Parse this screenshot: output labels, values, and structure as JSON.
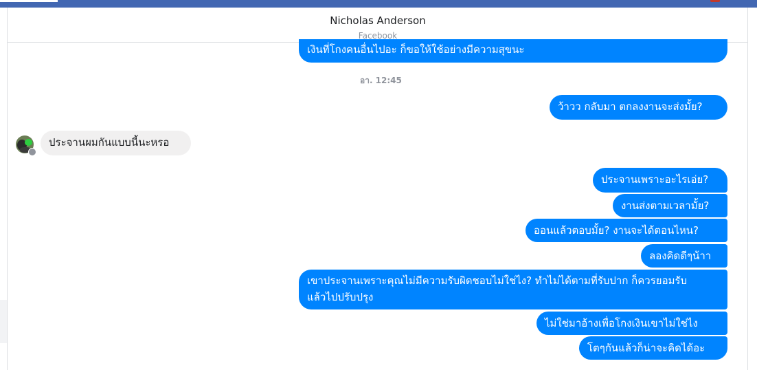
{
  "header": {
    "contact_name": "Nicholas Anderson",
    "contact_source": "Facebook"
  },
  "conversation": {
    "timestamp": "อา. 12:45",
    "messages": [
      {
        "sender": "me",
        "text": "เงินที่โกงคนอื่นไปอะ ก็ขอให้ใช้อย่างมีความสุขนะ"
      },
      {
        "sender": "me",
        "text": "ว้าวว กลับมา ตกลงงานจะส่งมั้ย?"
      },
      {
        "sender": "contact",
        "text": "ประจานผมกันแบบนี้นะหรอ"
      },
      {
        "sender": "me",
        "text": "ประจานเพราะอะไรเอ่ย?"
      },
      {
        "sender": "me",
        "text": "งานส่งตามเวลามั้ย?"
      },
      {
        "sender": "me",
        "text": "ออนแล้วตอบมั้ย? งานจะได้ตอนไหน?"
      },
      {
        "sender": "me",
        "text": "ลองคิดดีๆน้าา"
      },
      {
        "sender": "me",
        "text": "เขาประจานเพราะคุณไม่มีความรับผิดชอบไม่ใช่ไง? ทำไม่ได้ตามที่รับปาก ก็ควรยอมรับ แล้วไปปรับปรุง"
      },
      {
        "sender": "me",
        "text": "ไม่ใช่มาอ้างเพื่อโกงเงินเขาไม่ใช่ไง"
      },
      {
        "sender": "me",
        "text": "โตๆกันแล้วก็น่าจะคิดได้อะ"
      }
    ]
  },
  "colors": {
    "top_bar": "#4267b2",
    "outgoing_bubble": "#0084ff",
    "incoming_bubble": "#f1f0f0"
  },
  "icons": [
    "contact-avatar",
    "presence-badge-icon"
  ]
}
